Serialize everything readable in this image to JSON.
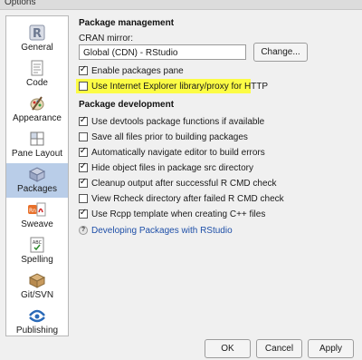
{
  "window": {
    "title": "Options"
  },
  "sidebar": {
    "items": [
      {
        "label": "General",
        "icon": "r-logo-icon",
        "selected": false
      },
      {
        "label": "Code",
        "icon": "code-document-icon",
        "selected": false
      },
      {
        "label": "Appearance",
        "icon": "paint-icon",
        "selected": false
      },
      {
        "label": "Pane Layout",
        "icon": "pane-layout-icon",
        "selected": false
      },
      {
        "label": "Packages",
        "icon": "package-box-icon",
        "selected": true
      },
      {
        "label": "Sweave",
        "icon": "sweave-pdf-icon",
        "selected": false
      },
      {
        "label": "Spelling",
        "icon": "spelling-abc-icon",
        "selected": false
      },
      {
        "label": "Git/SVN",
        "icon": "git-box-icon",
        "selected": false
      },
      {
        "label": "Publishing",
        "icon": "publishing-icon",
        "selected": false
      }
    ]
  },
  "main": {
    "package_management": {
      "title": "Package management",
      "cran_label": "CRAN mirror:",
      "cran_value": "Global (CDN) - RStudio",
      "change_button": "Change...",
      "options": [
        {
          "label": "Enable packages pane",
          "checked": true
        },
        {
          "label": "Use Internet Explorer library/proxy for HTTP",
          "checked": false,
          "highlighted": true
        }
      ]
    },
    "package_development": {
      "title": "Package development",
      "options": [
        {
          "label": "Use devtools package functions if available",
          "checked": true
        },
        {
          "label": "Save all files prior to building packages",
          "checked": false
        },
        {
          "label": "Automatically navigate editor to build errors",
          "checked": true
        },
        {
          "label": "Hide object files in package src directory",
          "checked": true
        },
        {
          "label": "Cleanup output after successful R CMD check",
          "checked": true
        },
        {
          "label": "View Rcheck directory after failed R CMD check",
          "checked": false
        },
        {
          "label": "Use Rcpp template when creating C++ files",
          "checked": true
        }
      ],
      "help_link": "Developing Packages with RStudio"
    }
  },
  "footer": {
    "ok": "OK",
    "cancel": "Cancel",
    "apply": "Apply"
  },
  "colors": {
    "selected_bg": "#b9cde8",
    "highlight": "#fcfc45",
    "link": "#1e4fa8"
  }
}
